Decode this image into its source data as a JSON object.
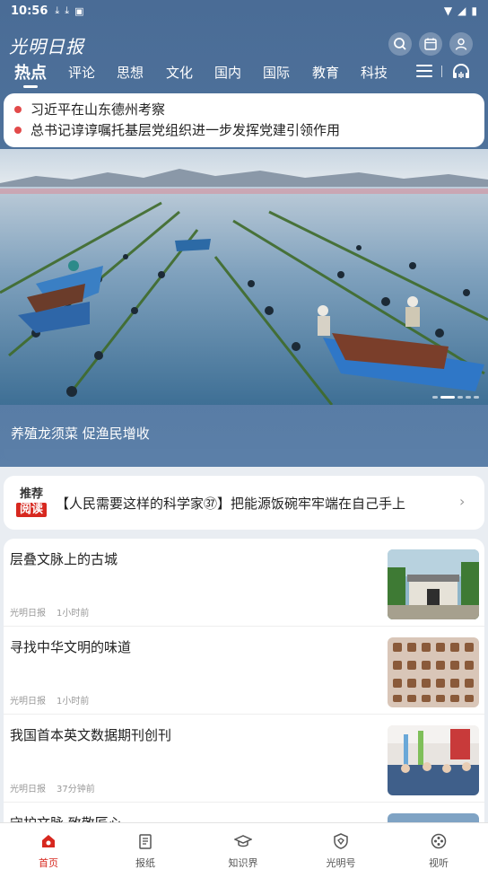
{
  "status_bar": {
    "time": "10:56"
  },
  "header": {
    "logo_text": "光明日报"
  },
  "tabs": [
    {
      "label": "热点",
      "active": true
    },
    {
      "label": "评论"
    },
    {
      "label": "思想"
    },
    {
      "label": "文化"
    },
    {
      "label": "国内"
    },
    {
      "label": "国际"
    },
    {
      "label": "教育"
    },
    {
      "label": "科技"
    }
  ],
  "headlines": [
    "习近平在山东德州考察",
    "总书记谆谆嘱托基层党组织进一步发挥党建引领作用"
  ],
  "banner": {
    "caption": "养殖龙须菜 促渔民增收",
    "page_count": 5,
    "active_page": 2
  },
  "recommend": {
    "badge_top": "推荐",
    "badge_bottom": "阅读",
    "text": "【人民需要这样的科学家㊲】把能源饭碗牢牢端在自己手上"
  },
  "news": [
    {
      "title": "层叠文脉上的古城",
      "source": "光明日报",
      "time": "1小时前"
    },
    {
      "title": "寻找中华文明的味道",
      "source": "光明日报",
      "time": "1小时前"
    },
    {
      "title": "我国首本英文数据期刊创刊",
      "source": "光明日报",
      "time": "37分钟前"
    },
    {
      "title": "守护文脉 致敬匠心",
      "source": "",
      "time": ""
    }
  ],
  "bottom_nav": [
    {
      "label": "首页",
      "icon": "home-icon",
      "active": true
    },
    {
      "label": "报纸",
      "icon": "newspaper-icon"
    },
    {
      "label": "知识界",
      "icon": "graduation-cap-icon"
    },
    {
      "label": "光明号",
      "icon": "shield-icon"
    },
    {
      "label": "视听",
      "icon": "film-reel-icon"
    }
  ],
  "colors": {
    "header_blue": "#4f739c",
    "accent_red": "#d7281f"
  }
}
